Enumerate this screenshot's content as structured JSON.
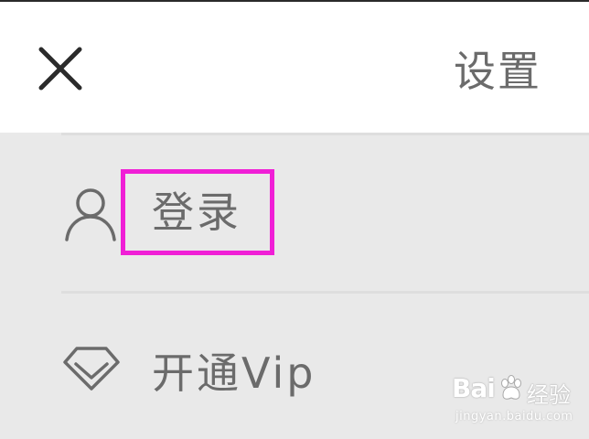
{
  "header": {
    "title": "设置",
    "close_icon": "close-icon"
  },
  "menu": {
    "items": [
      {
        "label": "登录",
        "icon": "user-icon",
        "highlighted": true,
        "highlight_color": "#f01fd6"
      },
      {
        "label": "开通Vip",
        "icon": "diamond-icon"
      }
    ]
  },
  "watermark": {
    "brand": "Bai",
    "brand_cn": "经验",
    "url": "jingyan.baidu.com"
  },
  "colors": {
    "header_bg": "#ffffff",
    "body_bg": "#e9e9e9",
    "text": "#6b6b6b",
    "highlight": "#f01fd6"
  }
}
